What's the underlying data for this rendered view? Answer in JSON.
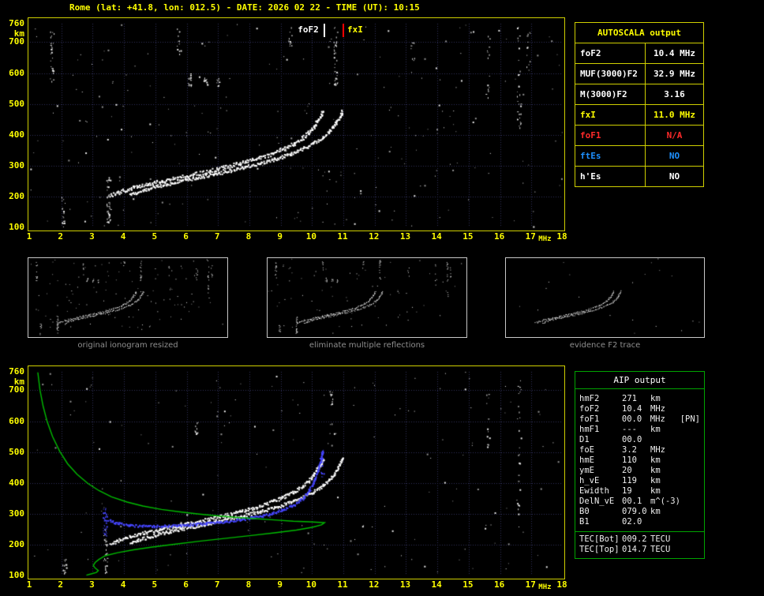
{
  "header": {
    "title": "Rome (lat: +41.8, lon: 012.5) - DATE: 2026 02 22 - TIME (UT): 10:15"
  },
  "palette": {
    "axis": "#ffff00",
    "plot_border": "#cfcf00",
    "grid": "#31315c",
    "trace": "#ffffff",
    "restored": "#4646ff",
    "profile": "#00bc00",
    "marker_red": "#ff0000",
    "aip_border": "#00a400",
    "caption": "#8f8f8f"
  },
  "top_plot": {
    "foF2_label": "foF2",
    "fxI_label": "fxI"
  },
  "axes": {
    "y_ticks": [
      760,
      700,
      600,
      500,
      400,
      300,
      200,
      100
    ],
    "y_unit": "km",
    "x_ticks": [
      1,
      2,
      3,
      4,
      5,
      6,
      7,
      8,
      9,
      10,
      11,
      12,
      13,
      14,
      15,
      16,
      17,
      18
    ],
    "x_unit": "MHz"
  },
  "autoscala": {
    "title": "AUTOSCALA output",
    "rows": [
      {
        "label": "foF2",
        "value": "10.4 MHz",
        "color": "white"
      },
      {
        "label": "MUF(3000)F2",
        "value": "32.9 MHz",
        "color": "white"
      },
      {
        "label": "M(3000)F2",
        "value": "3.16",
        "color": "white"
      },
      {
        "label": "fxI",
        "value": "11.0 MHz",
        "color": "yellow"
      },
      {
        "label": "foF1",
        "value": "N/A",
        "color": "red"
      },
      {
        "label": "ftEs",
        "value": "NO",
        "color": "blue"
      },
      {
        "label": "h'Es",
        "value": "NO",
        "color": "white"
      }
    ]
  },
  "thumbnails": [
    {
      "caption": "original ionogram resized"
    },
    {
      "caption": "eliminate multiple reflections"
    },
    {
      "caption": "evidence F2 trace"
    }
  ],
  "aip": {
    "title": "AIP output",
    "rows": [
      {
        "name": "hmF2",
        "value": "271",
        "unit": "km",
        "extra": ""
      },
      {
        "name": "foF2",
        "value": "10.4",
        "unit": "MHz",
        "extra": ""
      },
      {
        "name": "foF1",
        "value": "00.0",
        "unit": "MHz",
        "extra": "[PN]"
      },
      {
        "name": "hmF1",
        "value": "---",
        "unit": "km",
        "extra": ""
      },
      {
        "name": "D1",
        "value": "00.0",
        "unit": "",
        "extra": ""
      },
      {
        "name": "foE",
        "value": "3.2",
        "unit": "MHz",
        "extra": ""
      },
      {
        "name": "hmE",
        "value": "110",
        "unit": "km",
        "extra": ""
      },
      {
        "name": "ymE",
        "value": "20",
        "unit": "km",
        "extra": ""
      },
      {
        "name": "h_vE",
        "value": "119",
        "unit": "km",
        "extra": ""
      },
      {
        "name": "Ewidth",
        "value": "19",
        "unit": "km",
        "extra": ""
      },
      {
        "name": "DelN_vE",
        "value": "00.1",
        "unit": "m^(-3)",
        "extra": ""
      },
      {
        "name": "B0",
        "value": "079.0",
        "unit": "km",
        "extra": ""
      },
      {
        "name": "B1",
        "value": "02.0",
        "unit": "",
        "extra": ""
      }
    ],
    "tec_rows": [
      {
        "name": "TEC[Bot]",
        "value": "009.2",
        "unit": "TECU"
      },
      {
        "name": "TEC[Top]",
        "value": "014.7",
        "unit": "TECU"
      }
    ]
  },
  "chart_data": {
    "type": "scatter",
    "title": "ionogram",
    "xlabel": "MHz",
    "ylabel": "km",
    "xlim": [
      1,
      18
    ],
    "ylim": [
      100,
      760
    ],
    "foF2_MHz": 10.4,
    "fxI_MHz": 11.0,
    "hmF2_km": 271,
    "x_trace_shift_MHz": 0.62,
    "o_trace": [
      [
        3.55,
        205
      ],
      [
        3.8,
        215
      ],
      [
        4.2,
        228
      ],
      [
        4.7,
        241
      ],
      [
        5.2,
        252
      ],
      [
        5.7,
        262
      ],
      [
        6.2,
        273
      ],
      [
        6.7,
        284
      ],
      [
        7.2,
        296
      ],
      [
        7.7,
        309
      ],
      [
        8.2,
        323
      ],
      [
        8.7,
        340
      ],
      [
        9.1,
        357
      ],
      [
        9.4,
        372
      ],
      [
        9.7,
        392
      ],
      [
        9.9,
        410
      ],
      [
        10.05,
        428
      ],
      [
        10.18,
        450
      ],
      [
        10.28,
        465
      ],
      [
        10.34,
        480
      ]
    ],
    "restored_trace_blue": [
      [
        3.5,
        280
      ],
      [
        3.8,
        270
      ],
      [
        4.2,
        264
      ],
      [
        4.8,
        261
      ],
      [
        5.4,
        262
      ],
      [
        6.0,
        265
      ],
      [
        6.6,
        270
      ],
      [
        7.2,
        276
      ],
      [
        7.8,
        284
      ],
      [
        8.4,
        295
      ],
      [
        9.0,
        312
      ],
      [
        9.4,
        330
      ],
      [
        9.7,
        352
      ],
      [
        9.9,
        378
      ],
      [
        10.05,
        405
      ],
      [
        10.18,
        440
      ],
      [
        10.28,
        480
      ],
      [
        10.32,
        505
      ]
    ],
    "density_profile_green": [
      [
        1.25,
        758
      ],
      [
        1.32,
        700
      ],
      [
        1.42,
        648
      ],
      [
        1.55,
        598
      ],
      [
        1.72,
        550
      ],
      [
        1.95,
        502
      ],
      [
        2.2,
        462
      ],
      [
        2.5,
        428
      ],
      [
        2.85,
        398
      ],
      [
        3.2,
        375
      ],
      [
        3.6,
        355
      ],
      [
        4.1,
        338
      ],
      [
        4.6,
        325
      ],
      [
        5.2,
        314
      ],
      [
        5.8,
        306
      ],
      [
        6.4,
        299
      ],
      [
        7.0,
        293
      ],
      [
        7.6,
        288
      ],
      [
        8.2,
        284
      ],
      [
        8.8,
        280
      ],
      [
        9.4,
        276
      ],
      [
        9.9,
        274
      ],
      [
        10.25,
        272
      ],
      [
        10.4,
        271
      ],
      [
        10.3,
        264
      ],
      [
        10.0,
        256
      ],
      [
        9.5,
        247
      ],
      [
        8.8,
        238
      ],
      [
        8.0,
        229
      ],
      [
        7.2,
        220
      ],
      [
        6.4,
        211
      ],
      [
        5.6,
        201
      ],
      [
        4.9,
        192
      ],
      [
        4.3,
        183
      ],
      [
        3.8,
        174
      ],
      [
        3.4,
        164
      ],
      [
        3.2,
        152
      ],
      [
        3.08,
        142
      ],
      [
        3.02,
        132
      ],
      [
        3.08,
        124
      ],
      [
        3.18,
        116
      ],
      [
        3.12,
        110
      ],
      [
        2.95,
        105
      ],
      [
        2.8,
        101
      ]
    ],
    "noise_columns_top": [
      {
        "f": 1.7,
        "h0": 560,
        "h1": 745,
        "n": 26
      },
      {
        "f": 2.05,
        "h0": 100,
        "h1": 200,
        "n": 18
      },
      {
        "f": 3.5,
        "h0": 110,
        "h1": 265,
        "n": 45
      },
      {
        "f": 5.75,
        "h0": 660,
        "h1": 745,
        "n": 12
      },
      {
        "f": 6.1,
        "h0": 560,
        "h1": 600,
        "n": 14
      },
      {
        "f": 6.6,
        "h0": 560,
        "h1": 590,
        "n": 10
      },
      {
        "f": 7.0,
        "h0": 555,
        "h1": 585,
        "n": 10
      },
      {
        "f": 9.3,
        "h0": 680,
        "h1": 750,
        "n": 10
      },
      {
        "f": 10.75,
        "h0": 560,
        "h1": 750,
        "n": 30
      },
      {
        "f": 13.2,
        "h0": 600,
        "h1": 700,
        "n": 8
      },
      {
        "f": 15.6,
        "h0": 520,
        "h1": 740,
        "n": 14
      },
      {
        "f": 16.6,
        "h0": 420,
        "h1": 750,
        "n": 30
      },
      {
        "f": 16.9,
        "h0": 600,
        "h1": 740,
        "n": 12
      }
    ],
    "noise_columns_bottom": [
      {
        "f": 2.1,
        "h0": 100,
        "h1": 160,
        "n": 14
      },
      {
        "f": 3.4,
        "h0": 110,
        "h1": 250,
        "n": 30
      },
      {
        "f": 6.3,
        "h0": 560,
        "h1": 600,
        "n": 10
      },
      {
        "f": 10.6,
        "h0": 560,
        "h1": 700,
        "n": 12
      },
      {
        "f": 15.6,
        "h0": 500,
        "h1": 700,
        "n": 12
      },
      {
        "f": 16.6,
        "h0": 300,
        "h1": 740,
        "n": 26
      }
    ],
    "blue_noise_columns": [
      {
        "f": 3.38,
        "h0": 230,
        "h1": 320,
        "n": 36
      },
      {
        "f": 10.3,
        "h0": 420,
        "h1": 520,
        "n": 26
      }
    ]
  }
}
